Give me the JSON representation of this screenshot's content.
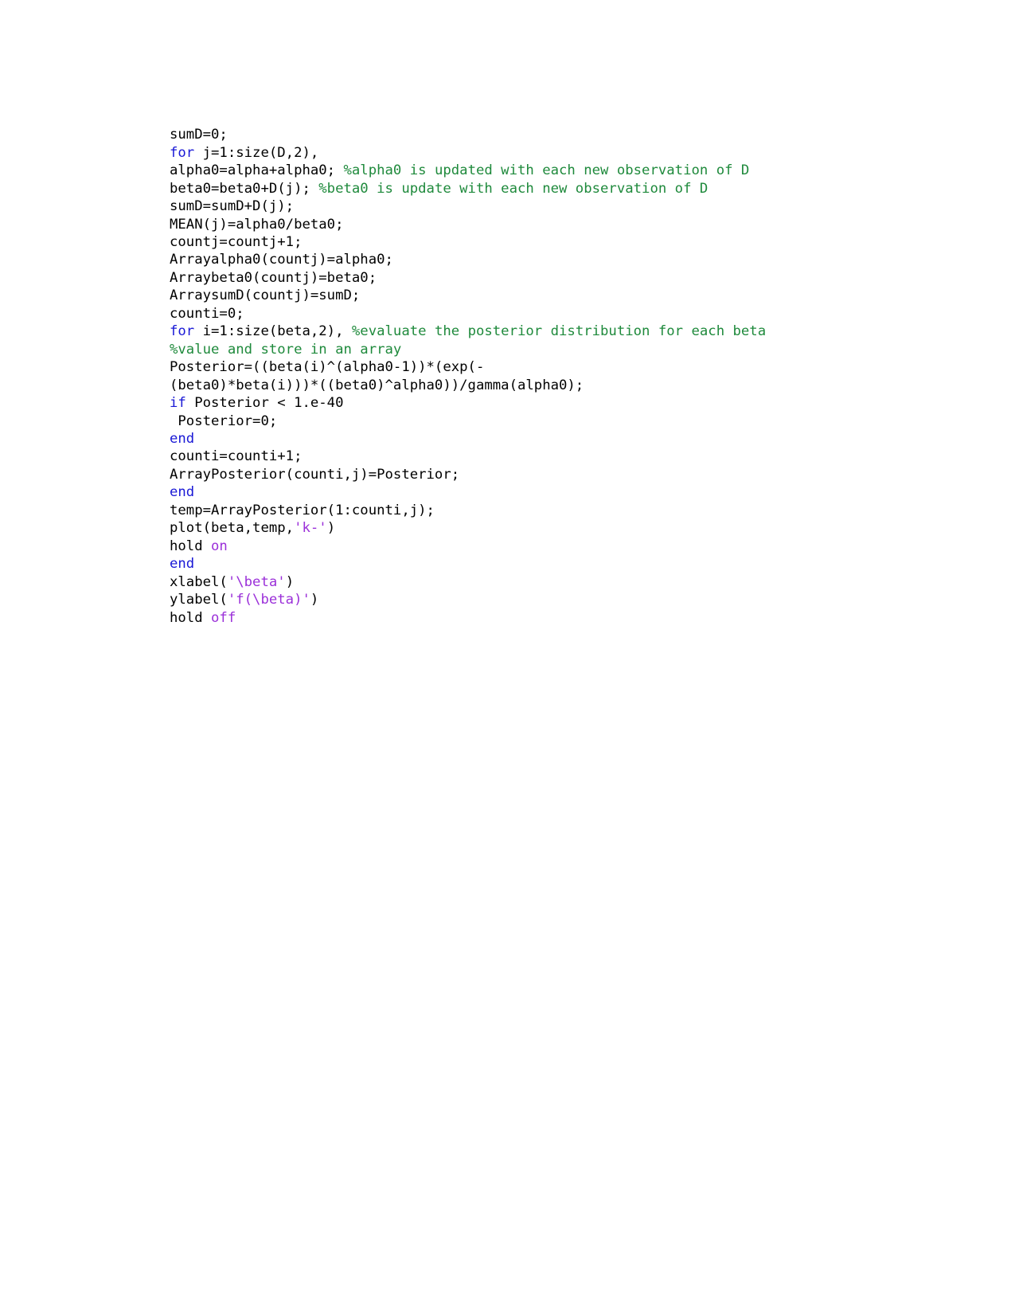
{
  "document": {
    "kind": "code-listing",
    "language": "MATLAB",
    "background_color": "#ffffff",
    "colors": {
      "plain": "#000000",
      "keyword": "#1a19d6",
      "comment": "#1f8a3c",
      "string": "#9b30d9"
    },
    "lines": [
      [
        {
          "t": "sumD=0;",
          "c": "plain"
        }
      ],
      [
        {
          "t": "for",
          "c": "keyword"
        },
        {
          "t": " j=1:size(D,2),",
          "c": "plain"
        }
      ],
      [
        {
          "t": "alpha0=alpha+alpha0; ",
          "c": "plain"
        },
        {
          "t": "%alpha0 is updated with each new observation of D",
          "c": "comment"
        }
      ],
      [
        {
          "t": "beta0=beta0+D(j); ",
          "c": "plain"
        },
        {
          "t": "%beta0 is update with each new observation of D",
          "c": "comment"
        }
      ],
      [
        {
          "t": "sumD=sumD+D(j);",
          "c": "plain"
        }
      ],
      [
        {
          "t": "MEAN(j)=alpha0/beta0;",
          "c": "plain"
        }
      ],
      [
        {
          "t": "countj=countj+1;",
          "c": "plain"
        }
      ],
      [
        {
          "t": "Arrayalpha0(countj)=alpha0;",
          "c": "plain"
        }
      ],
      [
        {
          "t": "Arraybeta0(countj)=beta0;",
          "c": "plain"
        }
      ],
      [
        {
          "t": "ArraysumD(countj)=sumD;",
          "c": "plain"
        }
      ],
      [
        {
          "t": "counti=0;",
          "c": "plain"
        }
      ],
      [
        {
          "t": "for",
          "c": "keyword"
        },
        {
          "t": " i=1:size(beta,2), ",
          "c": "plain"
        },
        {
          "t": "%evaluate the posterior distribution for each beta",
          "c": "comment"
        }
      ],
      [
        {
          "t": "%value and store in an array",
          "c": "comment"
        }
      ],
      [
        {
          "t": "Posterior=((beta(i)^(alpha0-1))*(exp(-",
          "c": "plain"
        }
      ],
      [
        {
          "t": "(beta0)*beta(i)))*((beta0)^alpha0))/gamma(alpha0);",
          "c": "plain"
        }
      ],
      [
        {
          "t": "if",
          "c": "keyword"
        },
        {
          "t": " Posterior < 1.e-40",
          "c": "plain"
        }
      ],
      [
        {
          "t": " Posterior=0;",
          "c": "plain"
        }
      ],
      [
        {
          "t": "end",
          "c": "keyword"
        }
      ],
      [
        {
          "t": "counti=counti+1;",
          "c": "plain"
        }
      ],
      [
        {
          "t": "ArrayPosterior(counti,j)=Posterior;",
          "c": "plain"
        }
      ],
      [
        {
          "t": "end",
          "c": "keyword"
        }
      ],
      [
        {
          "t": "temp=ArrayPosterior(1:counti,j);",
          "c": "plain"
        }
      ],
      [
        {
          "t": "plot(beta,temp,",
          "c": "plain"
        },
        {
          "t": "'k-'",
          "c": "string"
        },
        {
          "t": ")",
          "c": "plain"
        }
      ],
      [
        {
          "t": "hold ",
          "c": "plain"
        },
        {
          "t": "on",
          "c": "string"
        }
      ],
      [
        {
          "t": "end",
          "c": "keyword"
        }
      ],
      [
        {
          "t": "xlabel(",
          "c": "plain"
        },
        {
          "t": "'\\beta'",
          "c": "string"
        },
        {
          "t": ")",
          "c": "plain"
        }
      ],
      [
        {
          "t": "ylabel(",
          "c": "plain"
        },
        {
          "t": "'f(\\beta)'",
          "c": "string"
        },
        {
          "t": ")",
          "c": "plain"
        }
      ],
      [
        {
          "t": "hold ",
          "c": "plain"
        },
        {
          "t": "off",
          "c": "string"
        }
      ]
    ]
  }
}
